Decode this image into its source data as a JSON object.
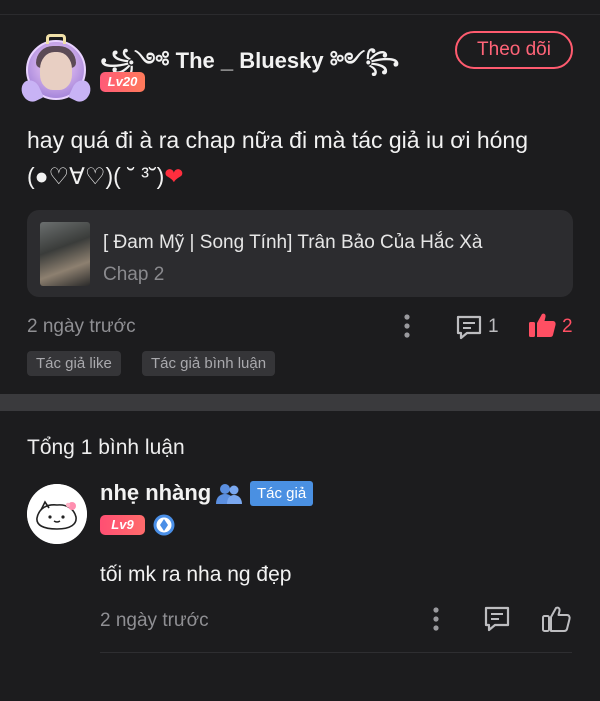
{
  "post": {
    "username": "꧁༺ The _ Bluesky ༻꧂",
    "level": "Lv20",
    "follow_label": "Theo dõi",
    "text": "hay quá đi à ra chap nữa đi mà tác giả iu ơi hóng (●♡∀♡)( ˘ ³˘)",
    "heart": "❤",
    "story": {
      "title": "[ Đam Mỹ | Song Tính] Trân Bảo Của Hắc Xà",
      "chapter": "Chap 2"
    },
    "time": "2 ngày trước",
    "comment_count": "1",
    "like_count": "2",
    "tags": [
      "Tác giả like",
      "Tác giả bình luận"
    ]
  },
  "comments": {
    "total": "Tổng 1 bình luận",
    "reply": {
      "name": "nhẹ nhàng",
      "badge": "Tác giả",
      "level": "Lv9",
      "text": "tối mk ra nha ng đẹp",
      "time": "2 ngày trước"
    }
  },
  "icons": {
    "more": "more-vertical-icon",
    "comment": "comment-icon",
    "like": "thumbs-up-icon",
    "people": "people-icon",
    "diamond": "diamond-badge-icon"
  },
  "colors": {
    "background": "#1c1c1e",
    "accent": "#ff5b6f",
    "card": "#2c2c2f",
    "author_badge": "#4a90e2",
    "muted": "#8f8f93"
  }
}
